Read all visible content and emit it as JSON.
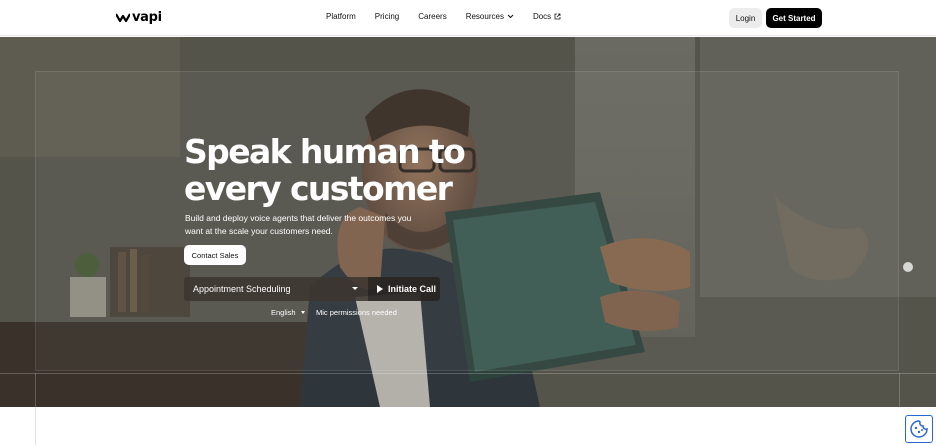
{
  "nav": {
    "logo_text": "vapi",
    "links": [
      {
        "label": "Platform",
        "has_chevron": false,
        "external": false
      },
      {
        "label": "Pricing",
        "has_chevron": false,
        "external": false
      },
      {
        "label": "Careers",
        "has_chevron": false,
        "external": false
      },
      {
        "label": "Resources",
        "has_chevron": true,
        "external": false
      },
      {
        "label": "Docs",
        "has_chevron": false,
        "external": true
      }
    ],
    "login_label": "Login",
    "cta_label": "Get Started"
  },
  "hero": {
    "headline_line1": "Speak human to",
    "headline_line2": "every customer",
    "subtext_line1": "Build and deploy voice agents that deliver the outcomes you",
    "subtext_line2": "want at the scale your customers need.",
    "contact_label": "Contact Sales",
    "use_case_selected": "Appointment Scheduling",
    "call_label": "Initiate Call",
    "language_selected": "English",
    "mic_note": "Mic permissions needed"
  },
  "colors": {
    "cta_bg": "#000000",
    "cookie_border": "#2b66d9"
  },
  "icons": {
    "logo": "vapi-wave-icon",
    "chevron": "chevron-down-icon",
    "external": "external-link-icon",
    "play": "play-icon",
    "cookie": "cookie-icon"
  }
}
